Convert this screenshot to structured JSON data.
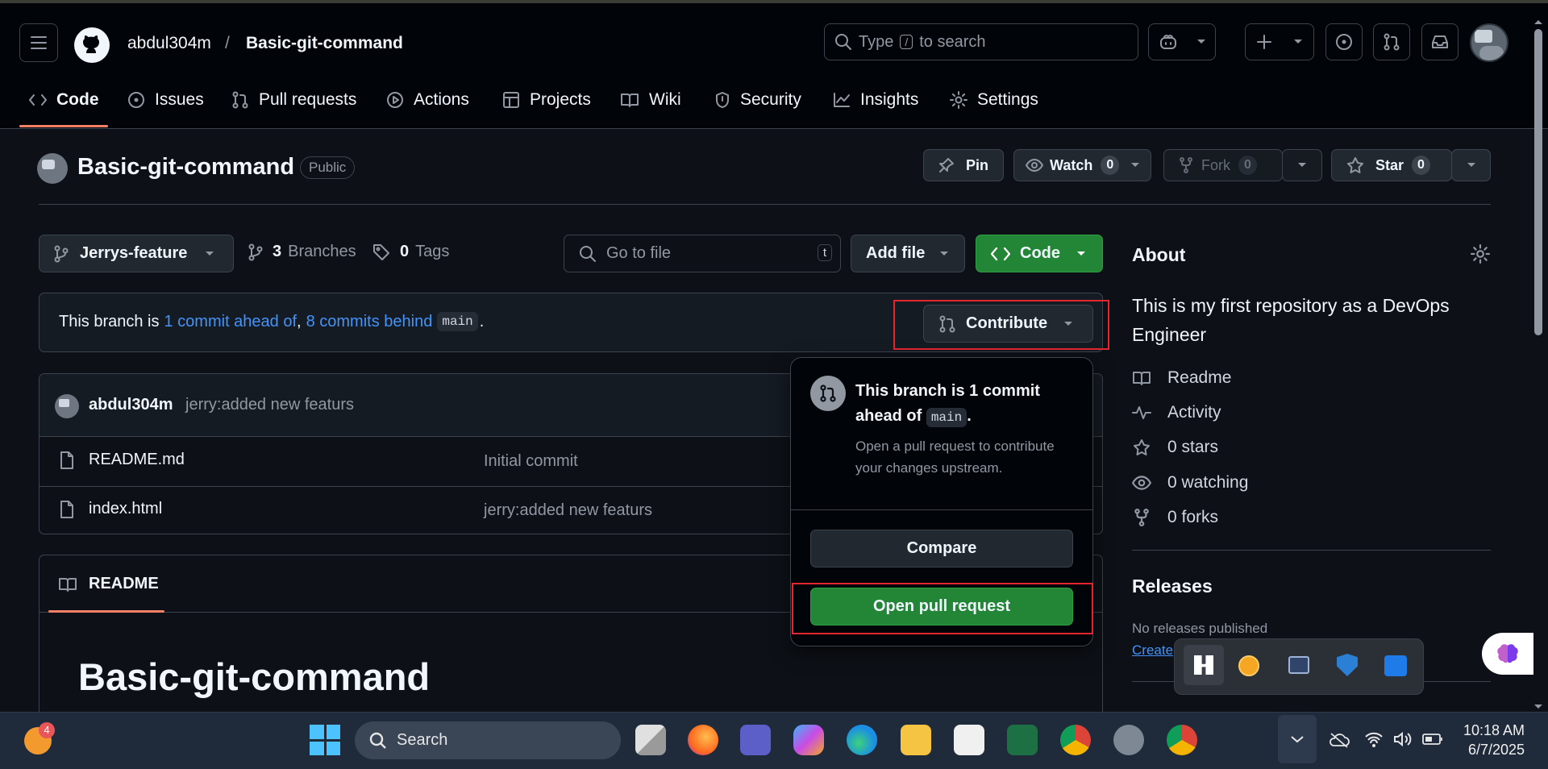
{
  "header": {
    "owner": "abdul304m",
    "separator": "/",
    "repo": "Basic-git-command",
    "search_placeholder_prefix": "Type",
    "search_key": "/",
    "search_placeholder_suffix": "to search"
  },
  "tabs": [
    {
      "label": "Code"
    },
    {
      "label": "Issues"
    },
    {
      "label": "Pull requests"
    },
    {
      "label": "Actions"
    },
    {
      "label": "Projects"
    },
    {
      "label": "Wiki"
    },
    {
      "label": "Security"
    },
    {
      "label": "Insights"
    },
    {
      "label": "Settings"
    }
  ],
  "repo_header": {
    "title": "Basic-git-command",
    "visibility": "Public",
    "pin_label": "Pin",
    "watch_label": "Watch",
    "watch_count": "0",
    "fork_label": "Fork",
    "fork_count": "0",
    "star_label": "Star",
    "star_count": "0"
  },
  "toolbar": {
    "branch": "Jerrys-feature",
    "branches_count": "3",
    "branches_label": "Branches",
    "tags_count": "0",
    "tags_label": "Tags",
    "goto_placeholder": "Go to file",
    "goto_key": "t",
    "add_file_label": "Add file",
    "code_label": "Code"
  },
  "branch_status": {
    "prefix": "This branch is",
    "ahead": "1 commit ahead of",
    "comma": ",",
    "behind": "8 commits behind",
    "base": "main",
    "suffix": ".",
    "contribute_label": "Contribute"
  },
  "commit": {
    "author": "abdul304m",
    "message": "jerry:added new featurs"
  },
  "files": [
    {
      "name": "README.md",
      "message": "Initial commit"
    },
    {
      "name": "index.html",
      "message": "jerry:added new featurs"
    }
  ],
  "readme": {
    "tab_label": "README",
    "heading": "Basic-git-command"
  },
  "popover": {
    "title_prefix": "This branch is 1 commit ahead of",
    "base": "main",
    "title_suffix": ".",
    "description": "Open a pull request to contribute your changes upstream.",
    "compare_label": "Compare",
    "open_pr_label": "Open pull request"
  },
  "about": {
    "heading": "About",
    "description": "This is my first repository as a DevOps Engineer",
    "readme": "Readme",
    "activity": "Activity",
    "stars": "0 stars",
    "watching": "0 watching",
    "forks": "0 forks"
  },
  "releases": {
    "heading": "Releases",
    "none": "No releases published",
    "create": "Create"
  },
  "taskbar": {
    "notification_count": "4",
    "search_label": "Search",
    "time": "10:18 AM",
    "date": "6/7/2025"
  },
  "colors": {
    "accent_green": "#238636",
    "link_blue": "#4493f8",
    "highlight_red": "#e5262e",
    "tab_underline": "#f78166"
  }
}
